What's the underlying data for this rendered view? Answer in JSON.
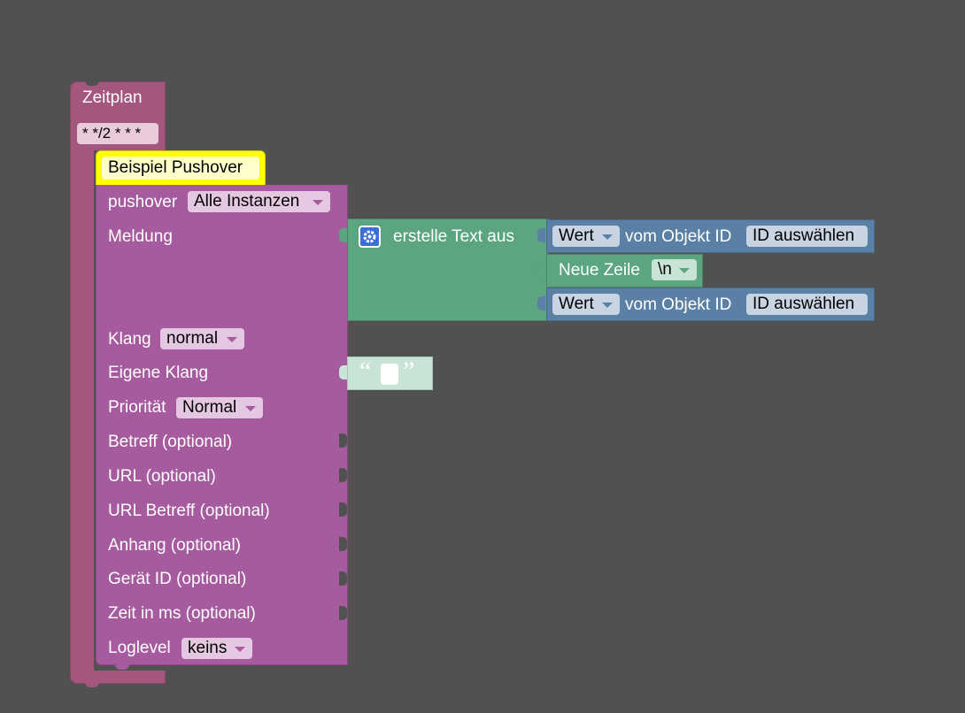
{
  "schedule": {
    "title": "Zeitplan",
    "cron": "* */2 * * *"
  },
  "comment": {
    "label": "Beispiel Pushover"
  },
  "pushover": {
    "label": "pushover",
    "instance": "Alle Instanzen",
    "message_label": "Meldung",
    "sound_label": "Klang",
    "sound_value": "normal",
    "own_sound_label": "Eigene Klang",
    "priority_label": "Priorität",
    "priority_value": "Normal",
    "subject_label": "Betreff (optional)",
    "url_label": "URL (optional)",
    "url_subject_label": "URL Betreff (optional)",
    "attachment_label": "Anhang (optional)",
    "device_label": "Gerät ID (optional)",
    "time_label": "Zeit in ms (optional)",
    "loglevel_label": "Loglevel",
    "loglevel_value": "keins"
  },
  "text_join": {
    "label": "erstelle Text aus"
  },
  "value1": {
    "mode": "Wert",
    "label": "vom Objekt ID",
    "id": "ID auswählen"
  },
  "newline": {
    "label": "Neue Zeile",
    "value": "\\n"
  },
  "value2": {
    "mode": "Wert",
    "label": "vom Objekt ID",
    "id": "ID auswählen"
  },
  "text_literal": {
    "open_quote": "“",
    "close_quote": "”"
  },
  "colors": {
    "schedule": "#a5567f",
    "pushover": "#a55b9e",
    "text": "#5ba580",
    "object": "#5b80a5",
    "comment": "#ffff00"
  }
}
